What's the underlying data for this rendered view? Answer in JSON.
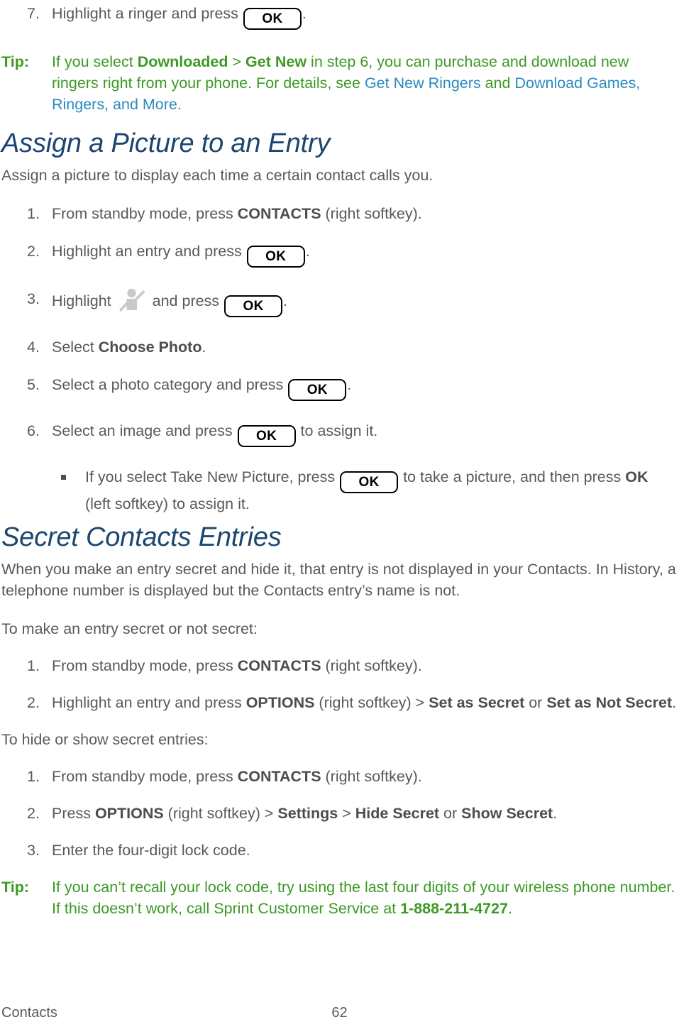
{
  "document": {
    "footer": {
      "left_label": "Contacts",
      "page_number": "62"
    },
    "colors": {
      "body_text": "#58595b",
      "heading": "#1c4670",
      "tip_green": "#3b9a23",
      "cross_reference_blue": "#2a8bbf",
      "key_border": "#000000"
    }
  },
  "step7": {
    "number": "7.",
    "text_before": "Highlight a ringer and press",
    "key": "OK",
    "text_after": "."
  },
  "tip1": {
    "label": "Tip:",
    "part1": "If you select ",
    "bold1": "Downloaded",
    "sep": " > ",
    "bold2": "Get New",
    "part2": " in step 6, you can purchase and download new ringers right from your phone. For details, see ",
    "link1": "Get New Ringers",
    "part3": " and ",
    "link2": "Download Games, Ringers, and More",
    "part4": "."
  },
  "section_assign_picture": {
    "heading": "Assign a Picture to an Entry",
    "intro": "Assign a picture to display each time a certain contact calls you.",
    "steps": [
      {
        "number": "1.",
        "before": "From standby mode, press ",
        "bold": "CONTACTS",
        "after": " (right softkey)."
      },
      {
        "number": "2.",
        "before": "Highlight an entry and press",
        "key": "OK",
        "after": "."
      },
      {
        "number": "3.",
        "before": "Highlight",
        "icon": "person-icon",
        "middle": "and press",
        "key": "OK",
        "after": "."
      },
      {
        "number": "4.",
        "before": "Select ",
        "bold": "Choose Photo",
        "after": "."
      },
      {
        "number": "5.",
        "before": "Select a photo category and press",
        "key": "OK",
        "after": "."
      },
      {
        "number": "6.",
        "before": "Select an image and press",
        "key": "OK",
        "after": " to assign it."
      }
    ],
    "substep": {
      "before": "If you select Take New Picture, press",
      "key": "OK",
      "middle": " to take a picture, and then press ",
      "bold": "OK",
      "after": " (left softkey) to assign it."
    }
  },
  "section_secret_contacts": {
    "heading": "Secret Contacts Entries",
    "intro": "When you make an entry secret and hide it, that entry is not displayed in your Contacts. In History, a telephone number is displayed but the Contacts entry’s name is not.",
    "lead_in_1": "To make an entry secret or not secret:",
    "steps_1": [
      {
        "number": "1.",
        "before": "From standby mode, press ",
        "bold": "CONTACTS",
        "after": " (right softkey)."
      },
      {
        "number": "2.",
        "before": "Highlight an entry and press ",
        "bold1": "OPTIONS",
        "mid1": " (right softkey) > ",
        "bold2": "Set as Secret",
        "mid2": " or ",
        "bold3": "Set as Not Secret",
        "after": "."
      }
    ],
    "lead_in_2": "To hide or show secret entries:",
    "steps_2": [
      {
        "number": "1.",
        "before": "From standby mode, press ",
        "bold": "CONTACTS",
        "after": " (right softkey)."
      },
      {
        "number": "2.",
        "before": "Press ",
        "bold1": "OPTIONS",
        "mid1": " (right softkey) > ",
        "bold2": "Settings",
        "mid2": " > ",
        "bold3": "Hide Secret",
        "mid3": " or ",
        "bold4": "Show Secret",
        "after": "."
      },
      {
        "number": "3.",
        "before": "Enter the four-digit lock code."
      }
    ]
  },
  "tip2": {
    "label": "Tip:",
    "part1": "If you can’t recall your lock code, try using the last four digits of your wireless phone number. If this doesn’t work, call Sprint Customer Service at ",
    "phone": "1-888-211-4727",
    "part2": "."
  }
}
